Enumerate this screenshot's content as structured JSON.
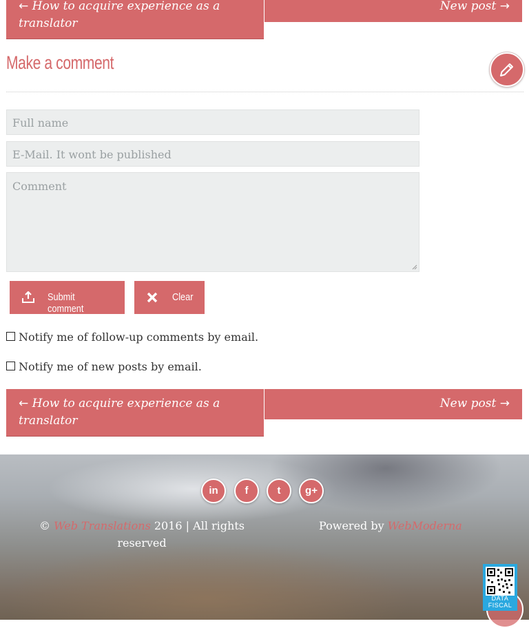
{
  "nav_top": {
    "prev": "How to acquire experience as a translator",
    "next": "New post"
  },
  "nav_bottom": {
    "prev": "How to acquire experience as a translator",
    "next": "New post"
  },
  "nav_arrows": {
    "left": "←",
    "right": "→"
  },
  "comment_section": {
    "title": "Make a comment",
    "name_placeholder": "Full name",
    "email_placeholder": "E-Mail. It wont be published",
    "comment_placeholder": "Comment",
    "submit_label": "Submit comment",
    "clear_label": "Clear",
    "notify_followup": "Notify me of follow-up comments by email.",
    "notify_posts": "Notify me of new posts by email."
  },
  "footer": {
    "social": [
      {
        "name": "linkedin-icon",
        "glyph": "in"
      },
      {
        "name": "facebook-icon",
        "glyph": "f"
      },
      {
        "name": "twitter-icon",
        "glyph": "t"
      },
      {
        "name": "google-plus-icon",
        "glyph": "g+"
      }
    ],
    "copyright_symbol": "©",
    "brand": "Web Translations",
    "rights": "2016 | All rights reserved",
    "powered_by": "Powered by",
    "powered_brand": "WebModerna",
    "badge_caption": "DATA FISCAL"
  },
  "colors": {
    "accent": "#d5696b",
    "field_bg": "#eceeee",
    "badge": "#2aa8df"
  }
}
